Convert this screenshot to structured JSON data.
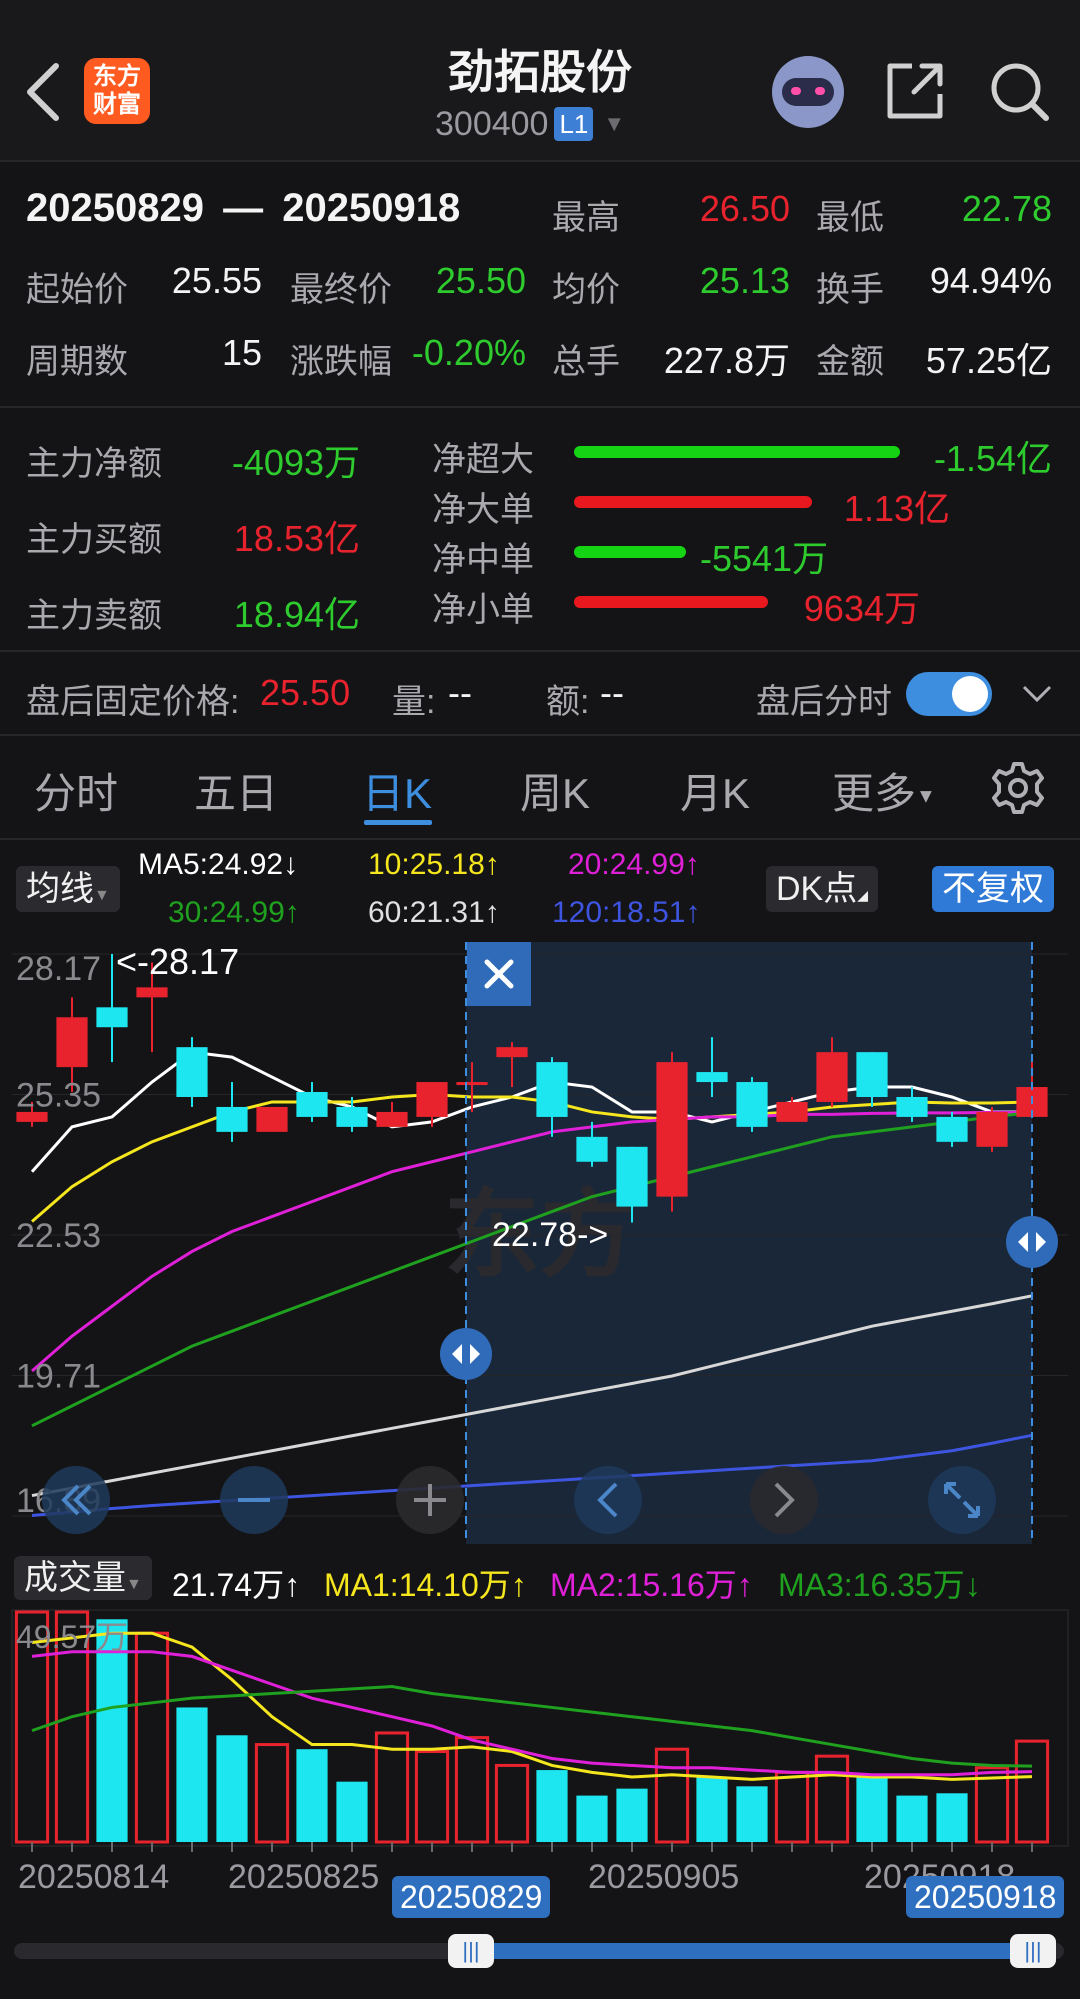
{
  "header": {
    "title": "劲拓股份",
    "code": "300400",
    "level": "L1",
    "logo_text_1": "东方",
    "logo_text_2": "财富"
  },
  "range": {
    "start": "20250829",
    "dash": "—",
    "end": "20250918"
  },
  "stats": {
    "high_label": "最高",
    "high": "26.50",
    "low_label": "最低",
    "low": "22.78",
    "open_label": "起始价",
    "open": "25.55",
    "close_label": "最终价",
    "close": "25.50",
    "avg_label": "均价",
    "avg": "25.13",
    "turnover_label": "换手",
    "turnover": "94.94%",
    "periods_label": "周期数",
    "periods": "15",
    "change_label": "涨跌幅",
    "change": "-0.20%",
    "volume_label": "总手",
    "volume": "227.8万",
    "amount_label": "金额",
    "amount": "57.25亿"
  },
  "flow": {
    "net_label": "主力净额",
    "net": "-4093万",
    "buy_label": "主力买额",
    "buy": "18.53亿",
    "sell_label": "主力卖额",
    "sell": "18.94亿",
    "items": [
      {
        "label": "净超大",
        "value": "-1.54亿",
        "color": "#14d414"
      },
      {
        "label": "净大单",
        "value": "1.13亿",
        "color": "#e8181e"
      },
      {
        "label": "净中单",
        "value": "-5541万",
        "color": "#14d414"
      },
      {
        "label": "净小单",
        "value": "9634万",
        "color": "#e8181e"
      }
    ]
  },
  "after_hours": {
    "price_label": "盘后固定价格:",
    "price": "25.50",
    "vol_label": "量:",
    "vol": "--",
    "amt_label": "额:",
    "amt": "--",
    "toggle_label": "盘后分时"
  },
  "tabs": [
    "分时",
    "五日",
    "日K",
    "周K",
    "月K",
    "更多"
  ],
  "active_tab": "日K",
  "ma_bar": {
    "selector": "均线",
    "ma5": "MA5:24.92↓",
    "ma10": "10:25.18↑",
    "ma20": "20:24.99↑",
    "ma30": "30:24.99↑",
    "ma60": "60:21.31↑",
    "ma120": "120:18.51↑",
    "dk": "DK点",
    "adjust": "不复权"
  },
  "colors": {
    "ma5": "#ffffff",
    "ma10": "#f5e61e",
    "ma20": "#e020d8",
    "ma30": "#1fa01f",
    "ma60": "#d8d8d8",
    "ma120": "#3d55e0",
    "up": "#e8232d",
    "down": "#1ee6f0",
    "accent": "#3e8ee0"
  },
  "chart_data": [
    {
      "type": "candlestick",
      "y_tick_labels": [
        "28.17",
        "25.35",
        "22.53",
        "19.71",
        "16.89"
      ],
      "ylim": [
        16.89,
        28.17
      ],
      "annotations": {
        "max_label": "<-28.17",
        "min_label": "22.78->"
      },
      "candles": [
        {
          "o": 24.8,
          "c": 25.0,
          "h": 25.2,
          "l": 24.7
        },
        {
          "o": 25.9,
          "c": 26.9,
          "h": 27.3,
          "l": 25.4
        },
        {
          "o": 27.1,
          "c": 26.7,
          "h": 28.17,
          "l": 26.0
        },
        {
          "o": 27.3,
          "c": 27.5,
          "h": 28.0,
          "l": 26.2
        },
        {
          "o": 26.3,
          "c": 25.3,
          "h": 26.5,
          "l": 25.1
        },
        {
          "o": 25.1,
          "c": 24.6,
          "h": 25.6,
          "l": 24.4
        },
        {
          "o": 24.6,
          "c": 25.1,
          "h": 25.1,
          "l": 24.6
        },
        {
          "o": 25.4,
          "c": 24.9,
          "h": 25.6,
          "l": 24.8
        },
        {
          "o": 25.1,
          "c": 24.7,
          "h": 25.3,
          "l": 24.6
        },
        {
          "o": 24.7,
          "c": 25.0,
          "h": 25.2,
          "l": 24.7
        },
        {
          "o": 24.9,
          "c": 25.6,
          "h": 25.6,
          "l": 24.7
        },
        {
          "o": 25.55,
          "c": 25.6,
          "h": 26.0,
          "l": 25.0
        },
        {
          "o": 26.1,
          "c": 26.3,
          "h": 26.4,
          "l": 25.5
        },
        {
          "o": 26.0,
          "c": 24.9,
          "h": 26.1,
          "l": 24.5
        },
        {
          "o": 24.5,
          "c": 24.0,
          "h": 24.8,
          "l": 23.9
        },
        {
          "o": 24.3,
          "c": 23.1,
          "h": 24.3,
          "l": 22.78
        },
        {
          "o": 23.3,
          "c": 26.0,
          "h": 26.2,
          "l": 23.0
        },
        {
          "o": 25.8,
          "c": 25.6,
          "h": 26.5,
          "l": 25.3
        },
        {
          "o": 25.6,
          "c": 24.7,
          "h": 25.7,
          "l": 24.6
        },
        {
          "o": 24.8,
          "c": 25.2,
          "h": 25.3,
          "l": 24.8
        },
        {
          "o": 25.2,
          "c": 26.2,
          "h": 26.5,
          "l": 25.1
        },
        {
          "o": 26.2,
          "c": 25.3,
          "h": 26.2,
          "l": 25.1
        },
        {
          "o": 25.3,
          "c": 24.9,
          "h": 25.5,
          "l": 24.8
        },
        {
          "o": 24.9,
          "c": 24.4,
          "h": 25.0,
          "l": 24.3
        },
        {
          "o": 24.3,
          "c": 25.0,
          "h": 25.1,
          "l": 24.2
        },
        {
          "o": 24.9,
          "c": 25.5,
          "h": 26.0,
          "l": 24.9
        }
      ],
      "series": [
        {
          "key": "ma5",
          "values": [
            23.8,
            24.7,
            24.9,
            25.6,
            26.2,
            26.1,
            25.7,
            25.3,
            25.1,
            24.7,
            24.8,
            25.1,
            25.3,
            25.6,
            25.5,
            25.0,
            25.0,
            24.8,
            25.0,
            25.2,
            25.4,
            25.5,
            25.5,
            25.3,
            25.0,
            25.0
          ]
        },
        {
          "key": "ma10",
          "values": [
            22.8,
            23.5,
            24.0,
            24.4,
            24.7,
            25.0,
            25.2,
            25.2,
            25.2,
            25.3,
            25.35,
            25.3,
            25.3,
            25.2,
            25.0,
            24.9,
            24.85,
            24.9,
            24.95,
            25.0,
            25.1,
            25.15,
            25.2,
            25.18,
            25.18,
            25.2
          ]
        },
        {
          "key": "ma20",
          "values": [
            19.8,
            20.5,
            21.1,
            21.7,
            22.2,
            22.6,
            22.9,
            23.2,
            23.5,
            23.8,
            24.0,
            24.2,
            24.4,
            24.6,
            24.7,
            24.8,
            24.85,
            24.9,
            24.9,
            24.95,
            24.95,
            24.97,
            24.98,
            24.98,
            24.99,
            24.99
          ]
        },
        {
          "key": "ma30",
          "values": [
            18.7,
            19.1,
            19.5,
            19.9,
            20.3,
            20.6,
            20.9,
            21.2,
            21.5,
            21.8,
            22.1,
            22.4,
            22.7,
            23.0,
            23.3,
            23.5,
            23.7,
            23.9,
            24.1,
            24.3,
            24.5,
            24.6,
            24.7,
            24.8,
            24.9,
            24.99
          ]
        },
        {
          "key": "ma60",
          "values": [
            17.3,
            17.45,
            17.6,
            17.75,
            17.9,
            18.05,
            18.2,
            18.35,
            18.5,
            18.65,
            18.8,
            18.95,
            19.1,
            19.25,
            19.4,
            19.55,
            19.7,
            19.9,
            20.1,
            20.3,
            20.5,
            20.7,
            20.85,
            21.0,
            21.15,
            21.31
          ]
        },
        {
          "key": "ma120",
          "values": [
            16.9,
            16.97,
            17.04,
            17.1,
            17.15,
            17.2,
            17.25,
            17.3,
            17.35,
            17.4,
            17.45,
            17.5,
            17.55,
            17.6,
            17.65,
            17.7,
            17.75,
            17.8,
            17.85,
            17.9,
            17.95,
            18.0,
            18.1,
            18.2,
            18.35,
            18.51
          ]
        }
      ]
    },
    {
      "type": "bar",
      "title": "成交量",
      "current": "21.74万↑",
      "ma1": "MA1:14.10万↑",
      "ma2": "MA2:15.16万↑",
      "ma3": "MA3:16.35万↓",
      "y_top_label": "49.57万",
      "ylim": [
        0,
        49.57
      ],
      "x_labels": [
        "20250814",
        "20250825",
        "20250905",
        "20250918"
      ],
      "volumes": [
        49.57,
        49.57,
        48.0,
        45.0,
        29.0,
        23.0,
        21.0,
        20.0,
        13.0,
        23.5,
        19.5,
        22.5,
        16.5,
        15.5,
        10.0,
        11.5,
        20.0,
        14.0,
        12.0,
        15.0,
        18.5,
        14.0,
        10.0,
        10.5,
        16.0,
        21.74
      ],
      "up_flags": [
        true,
        true,
        false,
        true,
        false,
        false,
        true,
        false,
        false,
        true,
        true,
        true,
        true,
        false,
        false,
        false,
        true,
        false,
        false,
        true,
        true,
        false,
        false,
        false,
        true,
        true
      ],
      "series": [
        {
          "key": "ma1",
          "values": [
            43.0,
            44.0,
            45.0,
            45.0,
            42.0,
            35.0,
            27.0,
            21.0,
            21.0,
            20.0,
            20.0,
            20.5,
            19.5,
            16.5,
            15.0,
            14.0,
            14.5,
            14.0,
            13.5,
            14.0,
            14.5,
            14.0,
            14.0,
            13.5,
            13.8,
            14.1
          ]
        },
        {
          "key": "ma2",
          "values": [
            40.0,
            41.0,
            41.0,
            41.0,
            40.0,
            37.0,
            34.0,
            31.0,
            29.0,
            27.0,
            25.0,
            22.0,
            20.0,
            18.0,
            17.0,
            16.5,
            16.0,
            16.0,
            15.5,
            15.0,
            15.0,
            14.5,
            14.5,
            14.5,
            15.0,
            15.16
          ]
        },
        {
          "key": "ma3",
          "values": [
            24.0,
            27.0,
            29.0,
            30.0,
            31.0,
            31.5,
            32.0,
            32.5,
            33.0,
            33.5,
            32.0,
            31.0,
            30.0,
            29.0,
            28.0,
            27.0,
            26.0,
            25.0,
            24.0,
            22.5,
            21.0,
            19.5,
            18.0,
            17.0,
            16.5,
            16.35
          ]
        }
      ]
    }
  ],
  "range_slider": {
    "left_label": "20250829",
    "right_label": "20250918"
  }
}
